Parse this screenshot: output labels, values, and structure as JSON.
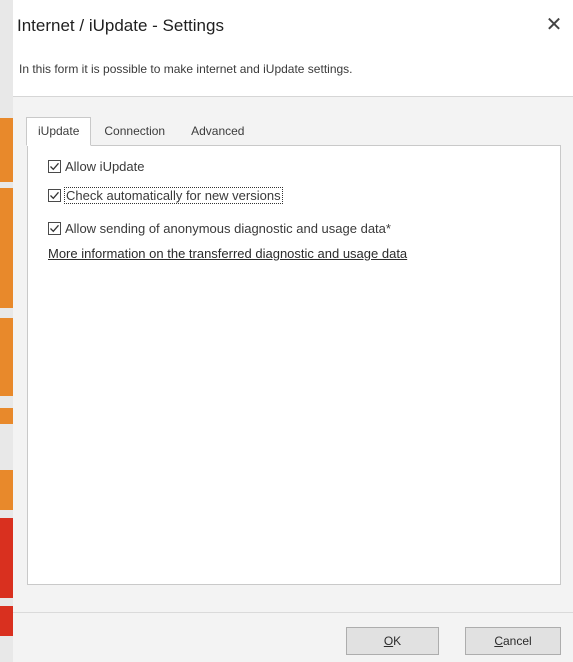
{
  "window": {
    "title": "Internet / iUpdate - Settings",
    "subtitle": "In this form it is possible to make internet and iUpdate settings.",
    "close_glyph": "✕"
  },
  "tabs": [
    {
      "label": "iUpdate",
      "active": true
    },
    {
      "label": "Connection",
      "active": false
    },
    {
      "label": "Advanced",
      "active": false
    }
  ],
  "iupdate_panel": {
    "allow_iupdate": {
      "label": "Allow iUpdate",
      "checked": true
    },
    "check_auto": {
      "label": "Check automatically for new versions",
      "checked": true
    },
    "allow_diag": {
      "label": "Allow sending of anonymous diagnostic and usage data*",
      "checked": true
    },
    "info_link": "More information on the transferred diagnostic and usage data"
  },
  "buttons": {
    "ok": {
      "accel": "O",
      "rest": "K"
    },
    "cancel": {
      "accel": "C",
      "rest": "ancel"
    }
  },
  "colors": {
    "edge_orange": "#e8892b",
    "edge_red": "#d9301f",
    "panel_bg": "#ffffff",
    "dialog_bg": "#f3f3f3"
  },
  "icons": {
    "close": "close-icon",
    "checkbox": "checkmark-icon"
  }
}
